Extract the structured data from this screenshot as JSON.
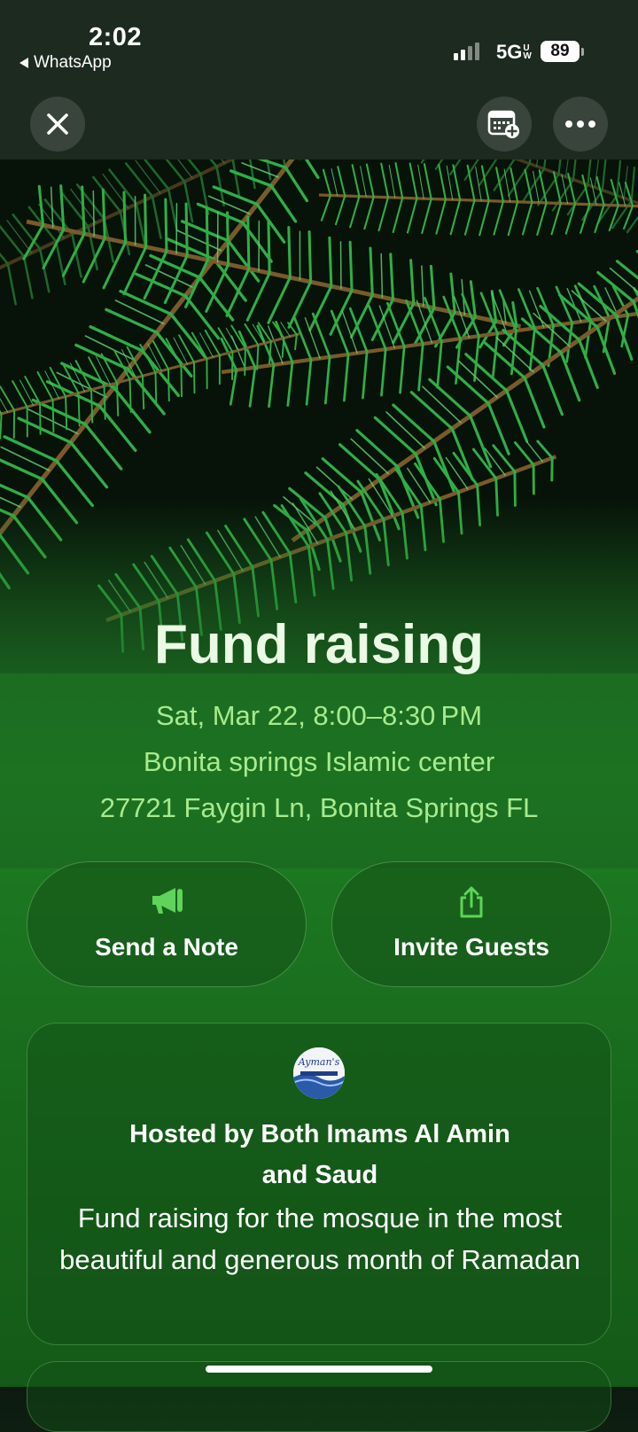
{
  "status_bar": {
    "time": "2:02",
    "back_app": "WhatsApp",
    "network": "5G",
    "network_badge_top": "U",
    "network_badge_bottom": "W",
    "battery": "89"
  },
  "nav": {
    "close_icon": "close-icon",
    "calendar_icon": "calendar-add-icon",
    "more_icon": "more-icon"
  },
  "event": {
    "title": "Fund raising",
    "date_time": "Sat, Mar 22, 8:00–8:30 PM",
    "venue": "Bonita springs Islamic center",
    "address": "27721 Faygin Ln, Bonita Springs FL"
  },
  "actions": {
    "send_note": "Send a Note",
    "invite_guests": "Invite Guests"
  },
  "host": {
    "avatar_text": "Ayman's",
    "name_line1": "Hosted by Both Imams Al Amin",
    "name_line2": "and Saud",
    "description": "Fund raising for the mosque in the most beautiful and generous month of Ramadan"
  },
  "colors": {
    "accent_green": "#5fd35a",
    "detail_text": "#a8ea8e",
    "title_text": "#eafae4"
  }
}
